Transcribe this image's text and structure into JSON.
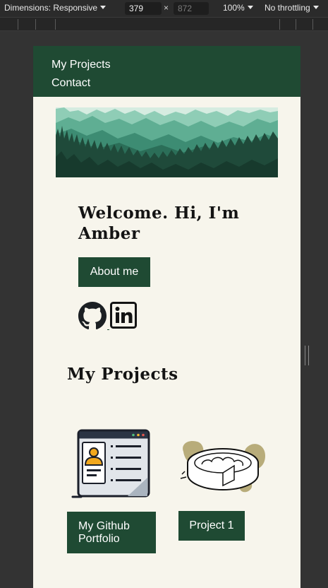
{
  "devtools": {
    "device_label": "Dimensions: Responsive",
    "width_value": "379",
    "height_placeholder": "872",
    "times": "×",
    "zoom": "100%",
    "throttling": "No throttling"
  },
  "site": {
    "nav": {
      "items": [
        "My Projects",
        "Contact"
      ]
    },
    "hero_image": "forest-mountains-banner",
    "welcome": "Welcome. Hi, I'm Amber",
    "about_button": "About me",
    "social": [
      "github-icon",
      "linkedin-icon"
    ],
    "projects_heading": "My Projects",
    "projects": [
      {
        "image": "portfolio-profile-window",
        "label": "My Github Portfolio"
      },
      {
        "image": "pie-illustration",
        "label": "Project 1"
      }
    ],
    "colors": {
      "nav_bg": "#1f4a33",
      "page_bg": "#f7f5ec",
      "button_bg": "#1f4a33",
      "text": "#141414"
    }
  }
}
